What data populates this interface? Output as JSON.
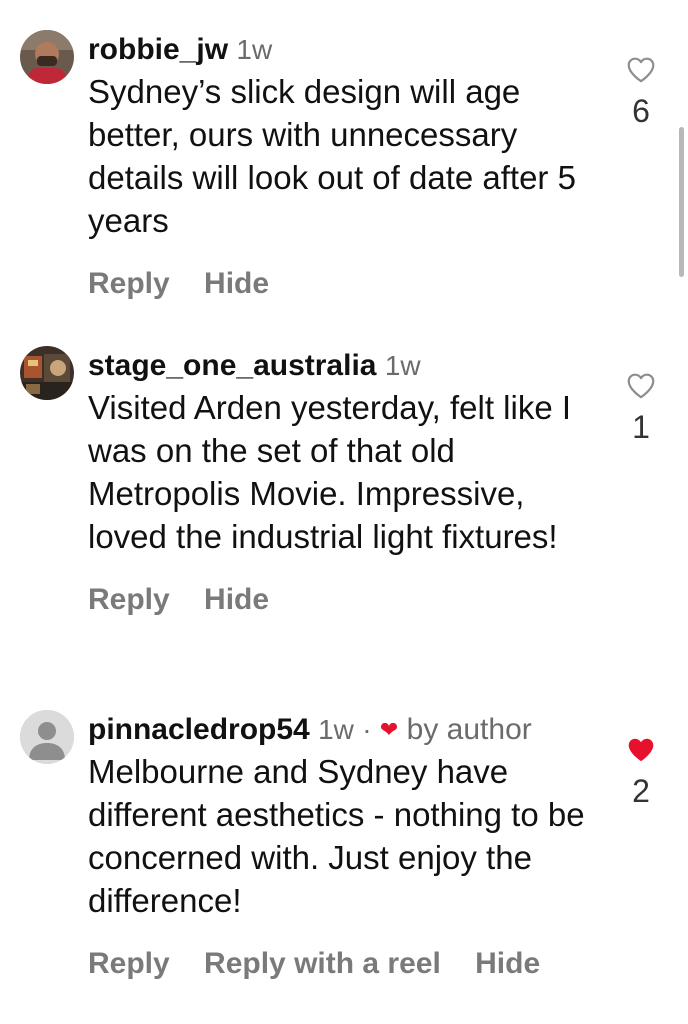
{
  "comments": [
    {
      "username": "robbie_jw",
      "time": "1w",
      "text": "Sydney’s slick design will age better, ours with unnecessary details will look out of date after 5 years",
      "actions": [
        "Reply",
        "Hide"
      ],
      "likes": "6",
      "liked": false
    },
    {
      "username": "stage_one_australia",
      "time": "1w",
      "text": "Visited Arden yesterday, felt like I was on the set of that old Metropolis Movie. Impressive, loved the industrial light fixtures!",
      "actions": [
        "Reply",
        "Hide"
      ],
      "likes": "1",
      "liked": false
    },
    {
      "username": "pinnacledrop54",
      "time": "1w",
      "separator": "·",
      "author_badge": "by author",
      "text": "Melbourne and Sydney have different aesthetics - nothing to be concerned with. Just enjoy the difference!",
      "actions": [
        "Reply",
        "Reply with a reel",
        "Hide"
      ],
      "likes": "2",
      "liked": true
    }
  ],
  "colors": {
    "like_active": "#e8112d",
    "muted_text": "#6b6b6b",
    "action_text": "#7a7a7a"
  },
  "icons": {
    "like": "heart-outline-icon",
    "liked": "heart-filled-icon",
    "avatar_default": "default-avatar-icon"
  }
}
